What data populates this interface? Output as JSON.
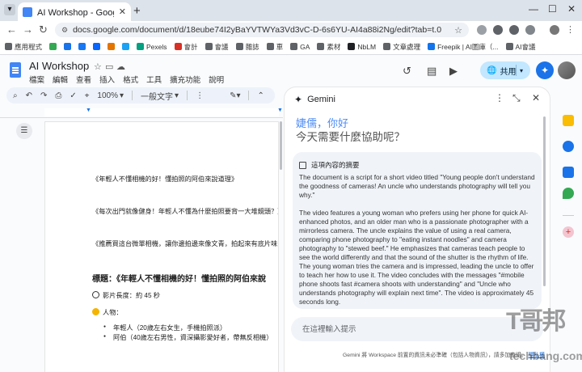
{
  "browser": {
    "tab_title": "AI Workshop - Google 文件",
    "new_tab": "+",
    "url": "docs.google.com/document/d/18eube74I2yBaYVTWYa3Vd3vC-D-6s6YU-AI4a88i2Ng/edit?tab=t.0",
    "bookmarks": [
      {
        "label": "應用程式",
        "color": "#5f6368"
      },
      {
        "label": "",
        "color": "#34a853"
      },
      {
        "label": "",
        "color": "#1a73e8"
      },
      {
        "label": "",
        "color": "#1877f2"
      },
      {
        "label": "",
        "color": "#0866ff"
      },
      {
        "label": "",
        "color": "#e37400"
      },
      {
        "label": "",
        "color": "#1da1f2"
      },
      {
        "label": "Pexels",
        "color": "#05a081"
      },
      {
        "label": "會計",
        "color": "#d93025"
      },
      {
        "label": "會議",
        "color": "#5f6368"
      },
      {
        "label": "雜誌",
        "color": "#5f6368"
      },
      {
        "label": "車",
        "color": "#5f6368"
      },
      {
        "label": "GA",
        "color": "#5f6368"
      },
      {
        "label": "素材",
        "color": "#5f6368"
      },
      {
        "label": "NbLM",
        "color": "#202124"
      },
      {
        "label": "文章處理",
        "color": "#5f6368"
      },
      {
        "label": "Freepik | AI圖庫（...",
        "color": "#1273eb"
      },
      {
        "label": "AI會議",
        "color": "#5f6368"
      }
    ]
  },
  "docs": {
    "title": "AI Workshop",
    "menu": [
      "檔案",
      "編輯",
      "查看",
      "插入",
      "格式",
      "工具",
      "擴充功能",
      "說明"
    ],
    "share_label": "共用",
    "zoom": "100%",
    "style": "一般文字",
    "lines": [
      "《年輕人不懂相機的好！懂拍照的阿伯來說道理》",
      "《每次出門就像健身！年輕人不懂為什麼拍照要背一大堆鏡頭？》",
      "《推薦買這台微單相機，讓你邊拍邊來像文青，拍起來有底片味！》"
    ],
    "heading": "標題：《年輕人不懂相機的好！懂拍照的阿伯來說",
    "length_label": "影片長度：約 45 秒",
    "people_label": "人物：",
    "people": [
      "年輕人（20歲左右女生，手機拍照派）",
      "阿伯（40歲左右男性，資深攝影愛好者，帶無反相機）"
    ]
  },
  "gemini": {
    "title": "Gemini",
    "greeting_name": "婕儒，你好",
    "greeting_question": "今天需要什麼協助呢？",
    "card_title": "這項內容的摘要",
    "summary_p1": "The document is a script for a short video titled \"Young people don't understand the goodness of cameras! An uncle who understands photography will tell you why.\"",
    "summary_p2": "The video features a young woman who prefers using her phone for quick AI-enhanced photos, and an older man who is a passionate photographer with a mirrorless camera. The uncle explains the value of using a real camera, comparing phone photography to \"eating instant noodles\" and camera photography to \"stewed beef.\" He emphasizes that cameras teach people to see the world differently and that the sound of the shutter is the rhythm of life. The young woman tries the camera and is impressed, leading the uncle to offer to teach her how to use it. The video concludes with the messages \"#mobile phone shoots fast #camera shoots with understanding\" and \"Uncle who understands photography will explain next time\". The video is approximately 45 seconds long.",
    "input_placeholder": "在這裡輸入提示",
    "footer_text": "Gemini 將 Workspace 前置的資訊未必準確（包括人物資訊），請多加查證。",
    "footer_link": "隱私權"
  },
  "watermark": {
    "zh": "T哥邦",
    "en": "techbang.com"
  },
  "colors": {
    "accent": "#1a73e8",
    "share_bg": "#c2e7ff",
    "gemini_name": "#4c8bf5"
  }
}
